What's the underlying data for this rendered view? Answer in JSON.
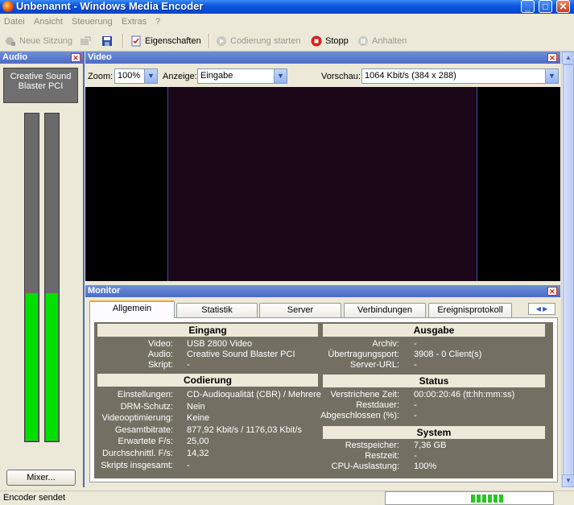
{
  "window": {
    "title": "Unbenannt - Windows Media Encoder"
  },
  "menu": [
    "Datei",
    "Ansicht",
    "Steuerung",
    "Extras",
    "?"
  ],
  "toolbar": {
    "new_session": "Neue Sitzung",
    "properties": "Eigenschaften",
    "start_encoding": "Codierung starten",
    "stop": "Stopp",
    "pause": "Anhalten"
  },
  "audio": {
    "title": "Audio",
    "device_line1": "Creative Sound",
    "device_line2": "Blaster PCI",
    "level_left": 0.45,
    "level_right": 0.45,
    "mixer_label": "Mixer..."
  },
  "video": {
    "title": "Video",
    "zoom_label": "Zoom:",
    "zoom_value": "100%",
    "view_label": "Anzeige:",
    "view_value": "Eingabe",
    "preview_label": "Vorschau:",
    "preview_value": "1064 Kbit/s (384 x 288)"
  },
  "monitor": {
    "title": "Monitor",
    "tabs": [
      "Allgemein",
      "Statistik",
      "Server",
      "Verbindungen",
      "Ereignisprotokoll"
    ],
    "input": {
      "title": "Eingang",
      "rows": [
        {
          "k": "Video:",
          "v": "USB 2800 Video"
        },
        {
          "k": "Audio:",
          "v": "Creative Sound Blaster PCI"
        },
        {
          "k": "Skript:",
          "v": "-"
        }
      ]
    },
    "output": {
      "title": "Ausgabe",
      "rows": [
        {
          "k": "Archiv:",
          "v": "-"
        },
        {
          "k": "Übertragungsport:",
          "v": "3908 - 0 Client(s)"
        },
        {
          "k": "Server-URL:",
          "v": "-"
        }
      ]
    },
    "encoding": {
      "title": "Codierung",
      "rows": [
        {
          "k": "Einstellungen:",
          "v": "CD-Audioqualität (CBR) / Mehrere"
        },
        {
          "k": "DRM-Schutz:",
          "v": "Nein"
        },
        {
          "k": "Videooptimierung:",
          "v": "Keine"
        },
        {
          "k": "Gesamtbitrate:",
          "v": "877,92 Kbit/s / 1176,03 Kbit/s"
        },
        {
          "k": "Erwartete F/s:",
          "v": "25,00"
        },
        {
          "k": "Durchschnittl. F/s:",
          "v": "14,32"
        },
        {
          "k": "Skripts insgesamt:",
          "v": "-"
        }
      ]
    },
    "status": {
      "title": "Status",
      "rows": [
        {
          "k": "Verstrichene Zeit:",
          "v": "00:00:20:46  (tt:hh:mm:ss)"
        },
        {
          "k": "Restdauer:",
          "v": "-"
        },
        {
          "k": "Abgeschlossen (%):",
          "v": "-"
        }
      ]
    },
    "system": {
      "title": "System",
      "rows": [
        {
          "k": "Restspeicher:",
          "v": "7,36 GB"
        },
        {
          "k": "Restzeit:",
          "v": "-"
        },
        {
          "k": "CPU-Auslastung:",
          "v": "100%"
        }
      ]
    }
  },
  "statusbar": {
    "text": "Encoder sendet"
  }
}
